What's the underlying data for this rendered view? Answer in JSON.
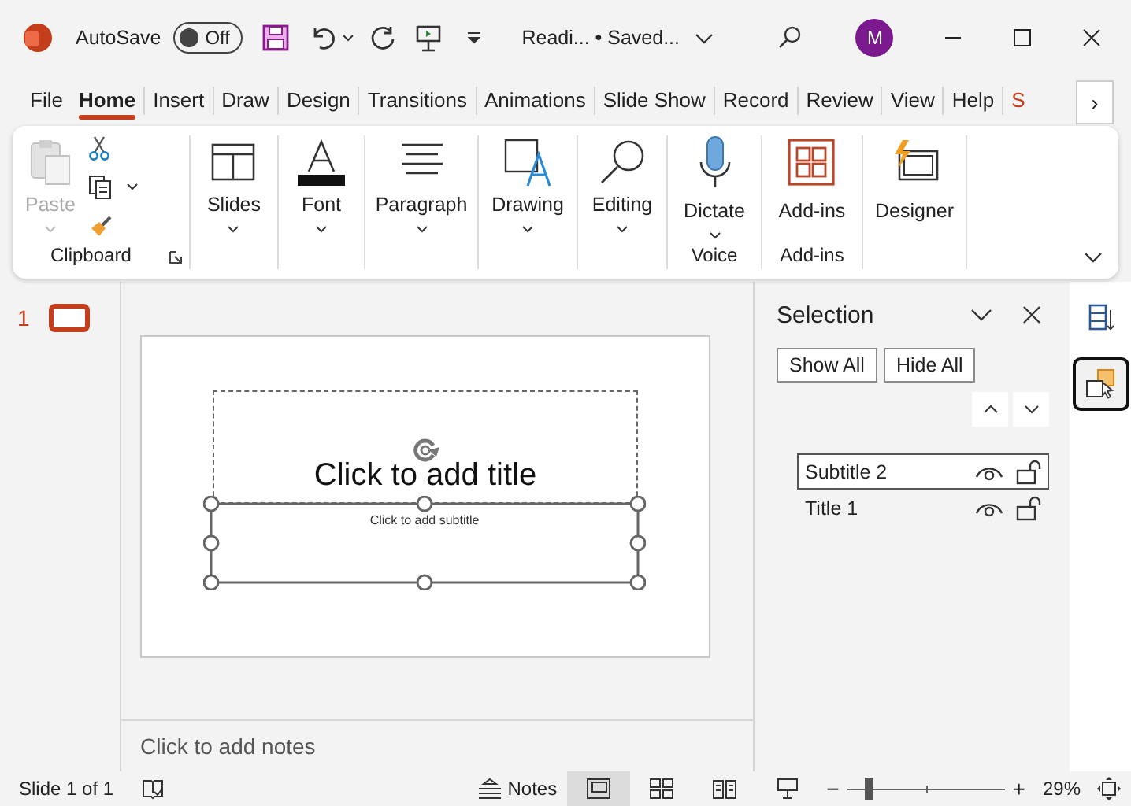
{
  "window": {
    "autosave_label": "AutoSave",
    "autosave_state": "Off",
    "autosave_on": false,
    "doc_title": "Readi... • Saved...",
    "avatar": "M"
  },
  "tabs": [
    {
      "label": "File",
      "selected": false
    },
    {
      "label": "Home",
      "selected": true
    },
    {
      "label": "Insert",
      "selected": false
    },
    {
      "label": "Draw",
      "selected": false
    },
    {
      "label": "Design",
      "selected": false
    },
    {
      "label": "Transitions",
      "selected": false
    },
    {
      "label": "Animations",
      "selected": false
    },
    {
      "label": "Slide Show",
      "selected": false
    },
    {
      "label": "Record",
      "selected": false
    },
    {
      "label": "Review",
      "selected": false
    },
    {
      "label": "View",
      "selected": false
    },
    {
      "label": "Help",
      "selected": false
    },
    {
      "label": "S",
      "selected": false,
      "contextual": true
    }
  ],
  "tabs_scroll": "›",
  "ribbon": {
    "groups": [
      {
        "label": "Clipboard",
        "launcher": true,
        "commands": [
          {
            "label": "Paste",
            "disabled": true,
            "dropdown": true
          }
        ]
      },
      {
        "commands": [
          {
            "label": "Slides",
            "dropdown": true
          }
        ]
      },
      {
        "commands": [
          {
            "label": "Font",
            "dropdown": true
          }
        ]
      },
      {
        "commands": [
          {
            "label": "Paragraph",
            "dropdown": true
          }
        ]
      },
      {
        "commands": [
          {
            "label": "Drawing",
            "dropdown": true
          }
        ]
      },
      {
        "commands": [
          {
            "label": "Editing",
            "dropdown": true
          }
        ]
      },
      {
        "label": "Voice",
        "commands": [
          {
            "label": "Dictate",
            "dropdown": true
          }
        ]
      },
      {
        "label": "Add-ins",
        "commands": [
          {
            "label": "Add-ins",
            "dropdown": false
          }
        ]
      },
      {
        "commands": [
          {
            "label": "Designer",
            "dropdown": false
          }
        ]
      }
    ]
  },
  "thumbnails": [
    {
      "number": "1",
      "selected": true
    }
  ],
  "slide": {
    "title_placeholder": "Click to add title",
    "subtitle_placeholder": "Click to add subtitle",
    "subtitle_selected": true
  },
  "notes": {
    "placeholder": "Click to add notes"
  },
  "selection_pane": {
    "title": "Selection",
    "buttons": [
      "Show All",
      "Hide All"
    ],
    "items": [
      {
        "label": "Subtitle 2",
        "selected": true,
        "visible": true,
        "locked": false
      },
      {
        "label": "Title 1",
        "selected": false,
        "visible": true,
        "locked": false
      }
    ]
  },
  "side_strip": [
    {
      "selected": false
    },
    {
      "selected": true
    }
  ],
  "status_bar": {
    "slide_info": "Slide 1 of 1",
    "notes_label": "Notes",
    "views": [
      {
        "selected": true
      },
      {
        "selected": false
      },
      {
        "selected": false
      },
      {
        "selected": false
      }
    ],
    "zoom_minus": "−",
    "zoom_plus": "+",
    "zoom": {
      "level": 0.13
    },
    "zoom_reading": "29%"
  }
}
